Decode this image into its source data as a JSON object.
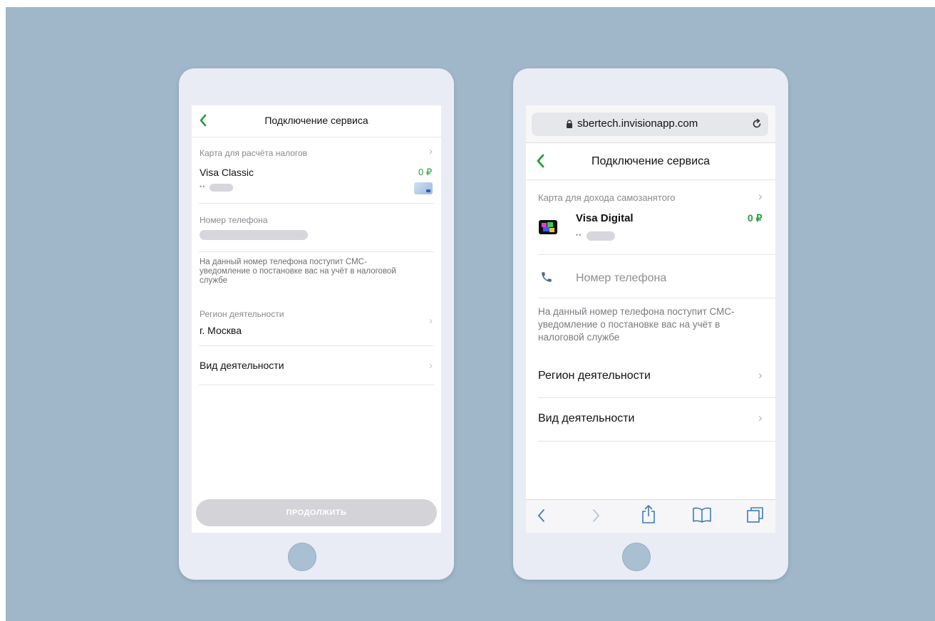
{
  "left_screen": {
    "nav_title": "Подключение сервиса",
    "card_section_label": "Карта для расчёта налогов",
    "card_name": "Visa Classic",
    "card_balance": "0 ₽",
    "card_mask": "••",
    "phone_label": "Номер телефона",
    "sms_note": "На данный номер телефона поступит СМС-уведомление о постановке вас на учёт в налоговой службе",
    "region_label": "Регион деятельности",
    "region_value": "г. Москва",
    "activity_label": "Вид деятельности",
    "continue_label": "ПРОДОЛЖИТЬ",
    "chevron": "›"
  },
  "right_screen": {
    "url": "sbertech.invisionapp.com",
    "nav_title": "Подключение сервиса",
    "card_section_label": "Карта для дохода самозанятого",
    "card_name": "Visa Digital",
    "card_balance": "0 ₽",
    "card_mask": "••",
    "phone_placeholder": "Номер телефона",
    "sms_note": "На данный номер телефона поступит СМС-уведомление о постановке вас на учёт в налоговой службе",
    "region_label": "Регион деятельности",
    "activity_label": "Вид деятельности",
    "chevron": "›"
  },
  "colors": {
    "accent_green": "#21a038",
    "background": "#9fb7c9",
    "phone_body": "#e9ecf4",
    "disabled_button": "#d3d3d8",
    "ios_blue": "#3b7bbf"
  },
  "icons": {
    "back": "chevron-left-icon",
    "lock": "lock-icon",
    "reload": "reload-icon",
    "phone": "phone-icon",
    "share": "share-icon",
    "bookmarks": "book-icon",
    "tabs": "tabs-icon"
  }
}
